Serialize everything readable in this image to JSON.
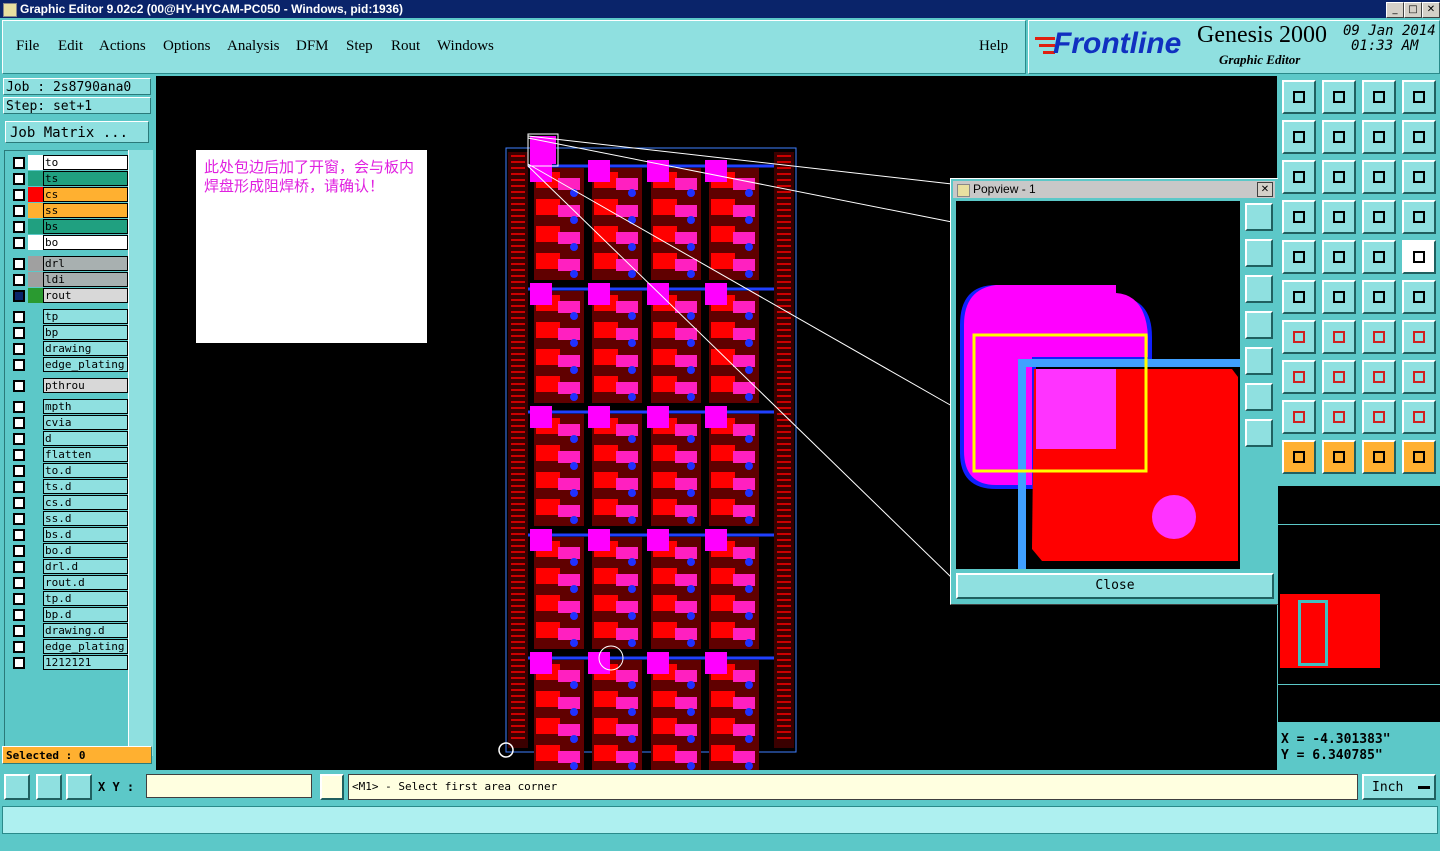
{
  "window": {
    "title": "Graphic Editor 9.02c2 (00@HY-HYCAM-PC050 - Windows, pid:1936)",
    "min": "_",
    "max": "□",
    "close": "✕"
  },
  "menu": [
    {
      "label": "File"
    },
    {
      "label": "Edit"
    },
    {
      "label": "Actions"
    },
    {
      "label": "Options"
    },
    {
      "label": "Analysis"
    },
    {
      "label": "DFM"
    },
    {
      "label": "Step"
    },
    {
      "label": "Rout"
    },
    {
      "label": "Windows"
    }
  ],
  "help_label": "Help",
  "brand": {
    "logo": "Frontline",
    "product": "Genesis 2000",
    "subtitle": "Graphic Editor",
    "date": "09 Jan 2014",
    "time": "01:33 AM"
  },
  "job": {
    "job_label": "Job : 2s8790ana0",
    "step_label": "Step: set+1",
    "matrix_button": "Job Matrix ..."
  },
  "layers_group1": [
    {
      "name": "to",
      "color": "#ffffff",
      "label_bg": "#ffffff"
    },
    {
      "name": "ts",
      "color": "#20a080",
      "label_bg": "#20a080"
    },
    {
      "name": "cs",
      "color": "#ff0000",
      "label_bg": "#ffb030"
    },
    {
      "name": "ss",
      "color": "#ffb030",
      "label_bg": "#ffb030"
    },
    {
      "name": "bs",
      "color": "#20a080",
      "label_bg": "#20a080"
    },
    {
      "name": "bo",
      "color": "#ffffff",
      "label_bg": "#ffffff"
    }
  ],
  "layers_group2": [
    {
      "name": "drl",
      "color": "#a0a0a0",
      "label_bg": "#a8b0b0"
    },
    {
      "name": "ldi",
      "color": "#a0a0a0",
      "label_bg": "#a8b0b0"
    },
    {
      "name": "rout",
      "color": "#2a9a30",
      "label_bg": "#d8d8d8"
    }
  ],
  "layers_group3": [
    "tp",
    "bp",
    "drawing",
    "edge_plating"
  ],
  "layers_group4": [
    "pthrou"
  ],
  "layers_group5": [
    "mpth",
    "cvia",
    "d",
    "flatten",
    "to.d",
    "ts.d",
    "cs.d",
    "ss.d",
    "bs.d",
    "bo.d",
    "drl.d",
    "rout.d",
    "tp.d",
    "bp.d",
    "drawing.d",
    "edge_plating",
    "1212121"
  ],
  "selected_label": "Selected : 0",
  "note_text": "此处包边后加了开窗，会与板内焊盘形成阻焊桥，请确认！",
  "popview": {
    "title": "Popview - 1",
    "close_label": "Close"
  },
  "coords": {
    "x": "X = -4.301383\"",
    "y": "Y = 6.340785\""
  },
  "status": {
    "xy_label": "X Y :",
    "xy_value": "",
    "prompt": "<M1> - Select first area corner",
    "units": "Inch"
  },
  "colors": {
    "panel": "#5cc8c8",
    "menu_bg": "#8fe0e0",
    "pad_magenta": "#ff00ff",
    "copper_red": "#ff0000",
    "selected_yellow": "#ffff00"
  }
}
